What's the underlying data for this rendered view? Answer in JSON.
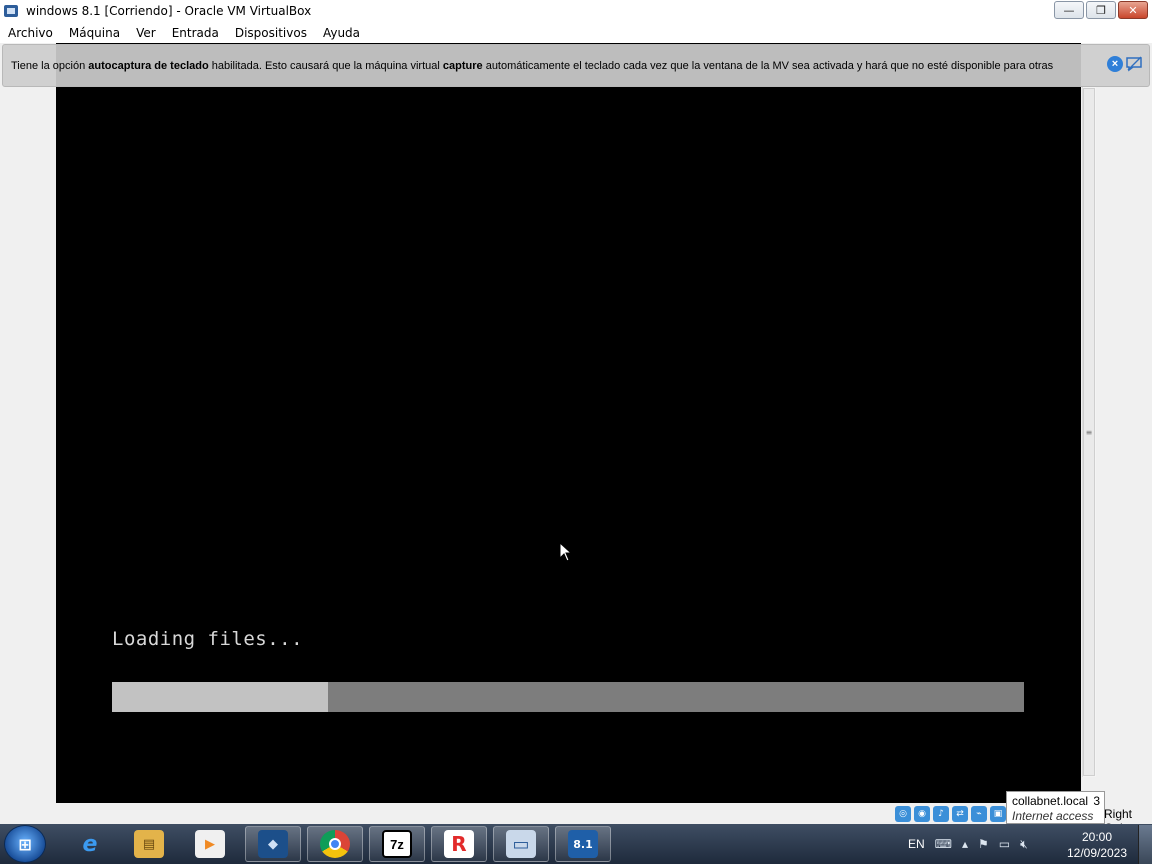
{
  "window": {
    "title": "windows 8.1 [Corriendo] - Oracle VM VirtualBox",
    "minimize_label": "—",
    "maximize_label": "❐",
    "close_label": "✕"
  },
  "menubar": {
    "items": [
      "Archivo",
      "Máquina",
      "Ver",
      "Entrada",
      "Dispositivos",
      "Ayuda"
    ]
  },
  "notice": {
    "part1": "Tiene la opción ",
    "bold1": "autocaptura de teclado",
    "part2": " habilitada. Esto causará que la máquina virtual ",
    "bold2": "capture",
    "part3": " automáticamente el teclado cada vez que la ventana de la MV sea activada y hará que no esté disponible para otras",
    "close_icon": "close-icon",
    "mute_icon": "message-icon"
  },
  "vm": {
    "loading_text": "Loading files...",
    "progress_fraction": 0.237,
    "progress_color_bg": "#7d7d7d",
    "progress_color_fill": "#c2c2c2"
  },
  "statusbar": {
    "host_key": "Right Ctrl"
  },
  "tooltip": {
    "line1": "collabnet.local",
    "count": "3",
    "line2": "Internet access"
  },
  "taskbar": {
    "items": [
      {
        "name": "internet-explorer",
        "glyph": "e",
        "color": "#2b7de0"
      },
      {
        "name": "file-explorer",
        "glyph": "▤",
        "color": "#e3b34a"
      },
      {
        "name": "media-player",
        "glyph": "▶",
        "color": "#f08a24"
      },
      {
        "name": "virtualbox",
        "glyph": "◆",
        "color": "#1c4f8a"
      },
      {
        "name": "chrome",
        "glyph": "◉",
        "color": "#d9372b"
      },
      {
        "name": "7zip",
        "glyph": "7z",
        "color": "#000000"
      },
      {
        "name": "roblox",
        "glyph": "R",
        "color": "#e22a2a"
      },
      {
        "name": "remote-desktop",
        "glyph": "▭",
        "color": "#4d7fbf"
      },
      {
        "name": "windows81-vm",
        "glyph": "8.1",
        "color": "#1f5fa8"
      }
    ],
    "language": "EN",
    "time": "20:00",
    "date": "12/09/2023"
  }
}
